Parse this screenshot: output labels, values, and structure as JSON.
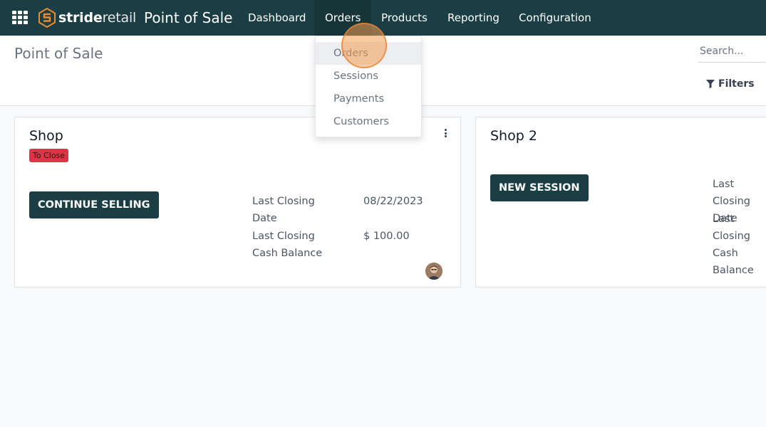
{
  "navbar": {
    "brand_bold": "stride",
    "brand_thin": "retail",
    "app_title": "Point of Sale",
    "items": [
      {
        "label": "Dashboard"
      },
      {
        "label": "Orders"
      },
      {
        "label": "Products"
      },
      {
        "label": "Reporting"
      },
      {
        "label": "Configuration"
      }
    ],
    "bg_color": "#1b3e45"
  },
  "orders_menu": {
    "items": [
      {
        "label": "Orders"
      },
      {
        "label": "Sessions"
      },
      {
        "label": "Payments"
      },
      {
        "label": "Customers"
      }
    ]
  },
  "control_panel": {
    "title": "Point of Sale",
    "search_placeholder": "Search...",
    "filters_label": "Filters"
  },
  "cards": [
    {
      "name": "Shop",
      "badge": "To Close",
      "badge_color": "#dc3545",
      "action": "CONTINUE SELLING",
      "info": [
        {
          "label_line1": "Last Closing",
          "label_line2": "Date",
          "value": "08/22/2023"
        },
        {
          "label_line1": "Last Closing",
          "label_line2": "Cash Balance",
          "value": "$ 100.00"
        }
      ]
    },
    {
      "name": "Shop 2",
      "action": "NEW SESSION",
      "info": [
        {
          "label_line1": "Last Closing",
          "label_line2": "Date"
        },
        {
          "label_line1": "Last Closing",
          "label_line2": "Cash Balance"
        }
      ]
    }
  ],
  "icons": {
    "apps": "grid-icon",
    "logo": "stride-logo-icon",
    "filter": "funnel-icon",
    "more": "vertical-dots-icon",
    "avatar": "user-avatar"
  }
}
